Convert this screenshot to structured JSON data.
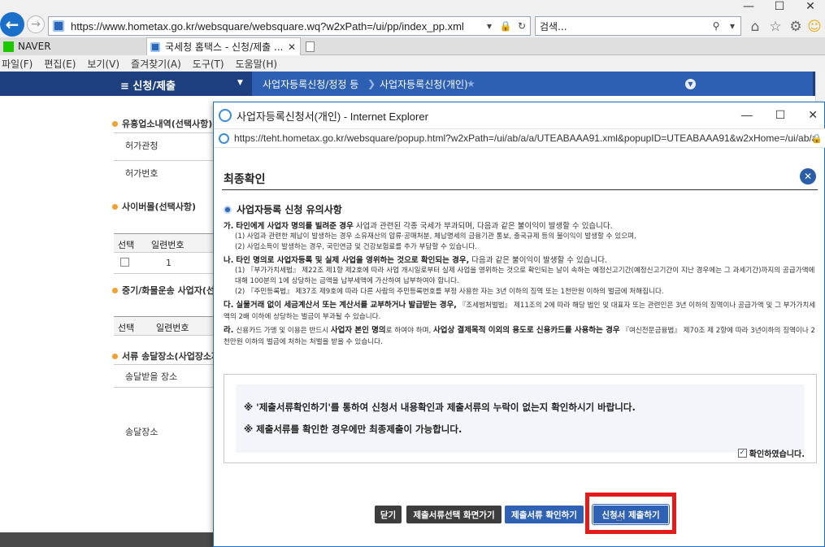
{
  "browser": {
    "url": "https://www.hometax.go.kr/websquare/websquare.wq?w2xPath=/ui/pp/index_pp.xml",
    "search_placeholder": "검색...",
    "tabs": [
      {
        "label": "NAVER"
      },
      {
        "label": "국세청 홈택스 - 신청/제출 ..."
      }
    ],
    "menu": [
      "파일(F)",
      "편집(E)",
      "보기(V)",
      "즐겨찾기(A)",
      "도구(T)",
      "도움말(H)"
    ]
  },
  "site": {
    "menu_title": "≡  신청/제출",
    "breadcrumb": [
      "사업자등록신청/정정 등",
      "사업자등록신청(개인)"
    ],
    "bg_sections": [
      {
        "label": "유흥업소내역(선택사항)"
      },
      {
        "label": "사이버몰(선택사항)"
      },
      {
        "label": "중기/화물운송 사업자(선"
      },
      {
        "label": "서류 송달장소(사업장소재"
      }
    ],
    "bg_rows": {
      "permit_office": "허가관청",
      "permit_no": "허가번호",
      "select": "선택",
      "serial": "일련번호",
      "row_num": "1",
      "select2": "선택",
      "serial2": "일련번호",
      "delivery_place": "송달받을 장소",
      "delivery": "송달장소"
    }
  },
  "popup": {
    "window_title": "사업자등록신청서(개인) - Internet Explorer",
    "url": "https://teht.hometax.go.kr/websquare/popup.html?w2xPath=/ui/ab/a/a/UTEABAAA91.xml&popupID=UTEABAAA91&w2xHome=/ui/ab/a/..",
    "final_title": "최종확인",
    "notice_heading": "사업자등록 신청 유의사항",
    "notes": [
      {
        "prefix": "가.",
        "bold": "타인에게 사업자 명의를 빌려준 경우",
        "rest": " 사업과 관련된 각종 국세가 부과되며, 다음과 같은 불이익이 발생할 수 있습니다.",
        "subs": [
          "(1) 사업과 관련한 체납이 발생하는 경우 소유재산의 압류·공매처분, 체납명세의 금융기관 통보, 출국규제 등의 불이익이 발생할 수 있으며,",
          "(2) 사업소득이 발생하는 경우, 국민연금 및 건강보험료를 추가 부담할 수 있습니다."
        ]
      },
      {
        "prefix": "나.",
        "bold": "타인 명의로 사업자등록 및 실제 사업을 영위하는 것으로 확인되는 경우,",
        "rest": " 다음과 같은 불이익이 발생할 수 있습니다.",
        "subs": [
          "(1) 『부가가치세법』 제22조 제1항 제2호에 따라 사업 개시일로부터 실제 사업을 영위하는 것으로 확인되는 날이 속하는 예정신고기간(예정신고기간이 지난 경우에는 그 과세기간)까지의 공급가액에 대해 100분의 1에 상당하는 금액을 납부세액에 가산하여 납부하여야 합니다.",
          "(2) 『주민등록법』 제37조 제9호에 따라 다른 사람의 주민등록번호를 부정 사용한 자는 3년 이하의 징역 또는 1천만원 이하의 벌금에 처해집니다."
        ]
      },
      {
        "prefix": "다.",
        "bold": "실물거래 없이 세금계산서 또는 계산서를 교부하거나 발급받는 경우,",
        "rest": " 『조세범처벌법』 제11조의 2에 따라 해당 법인 및 대표자 또는 관련인은 3년 이하의 징역이나 공급가액 및 그 부가가치세액의 2배 이하에 상당하는 벌금이 부과될 수 있습니다.",
        "subs": []
      },
      {
        "prefix": "라.",
        "pre": "신용카드 가맹 및 이용은 반드시 ",
        "bold": "사업자 본인 명의",
        "mid": "로 하여야 하며, ",
        "bold2": "사업상 결제목적 이외의 용도로 신용카드를 사용하는 경우",
        "rest": " 『여신전문금융법』 제70조 제 2항에 따라 3년이하의 징역이나 2천만원 이하의 벌금에 처하는 처벌을 받을 수 있습니다.",
        "subs": []
      }
    ],
    "confirm_lines": [
      "※  '제출서류확인하기'를 통하여 신청서 내용확인과 제출서류의 누락이 없는지 확인하시기 바랍니다.",
      "※  제출서류를 확인한 경우에만 최종제출이 가능합니다."
    ],
    "confirm_checkbox_label": "확인하였습니다.",
    "buttons": {
      "close": "닫기",
      "goto_doc_select": "제출서류선택 화면가기",
      "check_docs": "제출서류 확인하기",
      "submit": "신청서 제출하기"
    }
  },
  "colors": {
    "site_nav": "#1d3f7e",
    "primary_button": "#2f62b5",
    "dark_button": "#3d3d3d",
    "highlight": "#e31b1b",
    "section_bullet": "#f2a12e"
  }
}
